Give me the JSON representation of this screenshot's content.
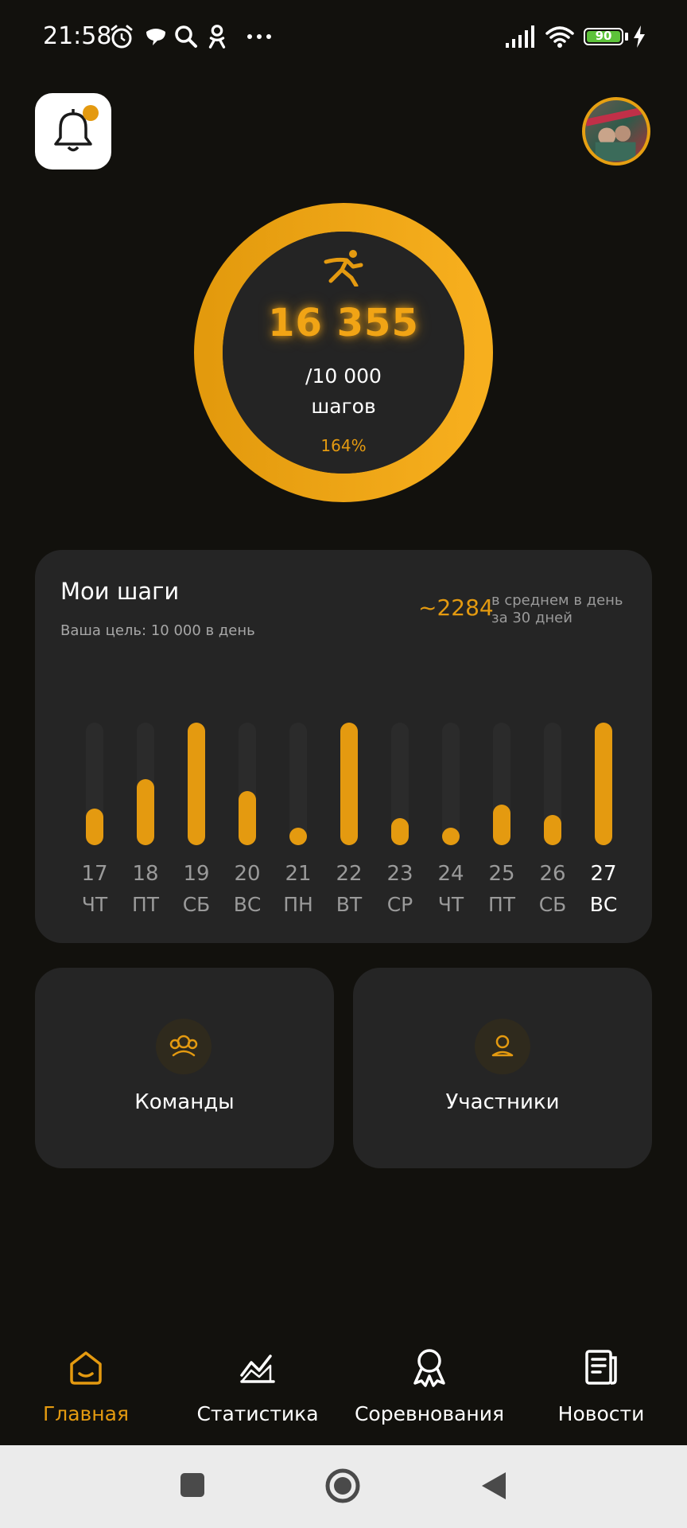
{
  "status_bar": {
    "time": "21:58",
    "battery_level": "90",
    "icons": [
      "alarm-icon",
      "chat-icon",
      "search-icon",
      "ok-icon",
      "more-dots-icon",
      "signal-icon",
      "wifi-icon",
      "battery-icon",
      "charging-icon"
    ]
  },
  "header": {
    "notification_dot": true,
    "icons": [
      "bell-icon",
      "avatar"
    ]
  },
  "progress": {
    "steps": "16 355",
    "goal": "/10 000",
    "unit": "шагов",
    "percent": "164%",
    "fraction": 1.0
  },
  "steps_card": {
    "title": "Мои шаги",
    "goal_text": "Ваша цель: 10 000 в день",
    "avg_value": "~2284",
    "avg_label_line1": "в среднем в день",
    "avg_label_line2": "за 30 дней",
    "days": [
      {
        "num": "17",
        "name": "ЧТ",
        "level": 0.3,
        "active": false
      },
      {
        "num": "18",
        "name": "ПТ",
        "level": 0.54,
        "active": false
      },
      {
        "num": "19",
        "name": "СБ",
        "level": 1.0,
        "active": false
      },
      {
        "num": "20",
        "name": "ВС",
        "level": 0.44,
        "active": false
      },
      {
        "num": "21",
        "name": "ПН",
        "level": 0.07,
        "active": false
      },
      {
        "num": "22",
        "name": "ВТ",
        "level": 1.0,
        "active": false
      },
      {
        "num": "23",
        "name": "СР",
        "level": 0.22,
        "active": false
      },
      {
        "num": "24",
        "name": "ЧТ",
        "level": 0.14,
        "active": false
      },
      {
        "num": "25",
        "name": "ПТ",
        "level": 0.33,
        "active": false
      },
      {
        "num": "26",
        "name": "СБ",
        "level": 0.25,
        "active": false
      },
      {
        "num": "27",
        "name": "ВС",
        "level": 1.0,
        "active": true
      }
    ]
  },
  "tiles": {
    "teams": "Команды",
    "participants": "Участники"
  },
  "nav": {
    "home": "Главная",
    "stats": "Статистика",
    "competitions": "Соревнования",
    "news": "Новости"
  },
  "colors": {
    "accent": "#e49a10",
    "background": "#12110d",
    "card": "#252525"
  }
}
